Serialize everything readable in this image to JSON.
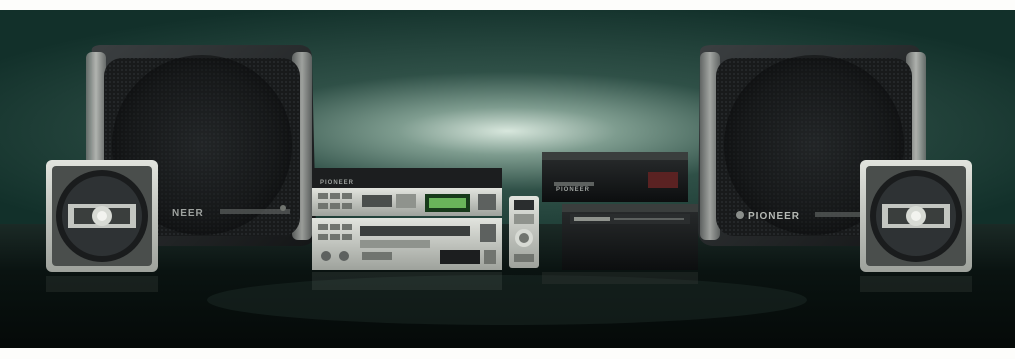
{
  "photo": {
    "brand_large_left": "NEER",
    "brand_large_right": "PIONEER",
    "brand_deck_top": "PIONEER",
    "brand_amp": "PIONEER",
    "colors": {
      "backdrop_center": "#cfe2d8",
      "backdrop_mid": "#3a5a50",
      "backdrop_edge": "#14302a",
      "floor": "#0a1210",
      "speaker_frame": "#26292b",
      "speaker_trim": "#8a8e8c",
      "silver": "#b9bcb6",
      "display_green": "#7ed36a",
      "amp_red": "#8a2a2a"
    }
  }
}
